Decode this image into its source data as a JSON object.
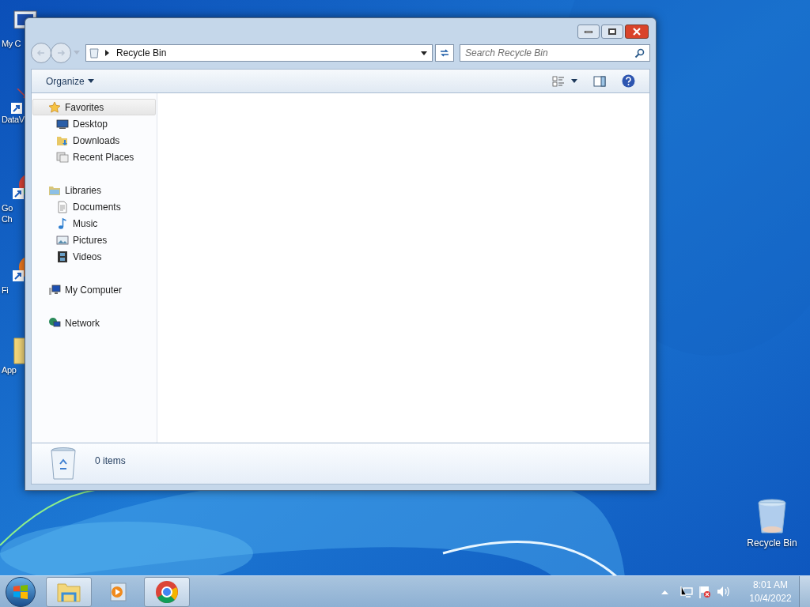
{
  "desktop_icons": [
    {
      "kind": "computer",
      "label_lines": [
        "My C"
      ]
    },
    {
      "kind": "shortcut",
      "label_lines": [
        "DataV"
      ]
    },
    {
      "kind": "chrome",
      "label_lines": [
        "Go",
        "Ch"
      ]
    },
    {
      "kind": "firefox",
      "label_lines": [
        "Fi"
      ]
    },
    {
      "kind": "folder",
      "label_lines": [
        "App"
      ]
    },
    {
      "kind": "recycle",
      "label_lines": [
        "Recycle Bin"
      ]
    }
  ],
  "window": {
    "address": {
      "path": "Recycle Bin"
    },
    "search": {
      "placeholder": "Search Recycle Bin"
    },
    "toolbar": {
      "organize": "Organize"
    },
    "sidebar": [
      {
        "label": "Favorites",
        "selected": true,
        "children": [
          {
            "label": "Desktop",
            "selected": false
          },
          {
            "label": "Downloads",
            "selected": false
          },
          {
            "label": "Recent Places",
            "selected": false
          }
        ]
      },
      {
        "label": "Libraries",
        "selected": false,
        "children": [
          {
            "label": "Documents",
            "selected": false
          },
          {
            "label": "Music",
            "selected": false
          },
          {
            "label": "Pictures",
            "selected": false
          },
          {
            "label": "Videos",
            "selected": false
          }
        ]
      },
      {
        "label": "My Computer",
        "selected": false
      },
      {
        "label": "Network",
        "selected": false
      }
    ],
    "details": {
      "count": "0 items"
    }
  },
  "taskbar": {
    "apps": [
      {
        "kind": "explorer",
        "running": true
      },
      {
        "kind": "media",
        "running": false
      },
      {
        "kind": "chrome",
        "running": true
      }
    ],
    "time": "8:01 AM",
    "date": "10/4/2022"
  }
}
